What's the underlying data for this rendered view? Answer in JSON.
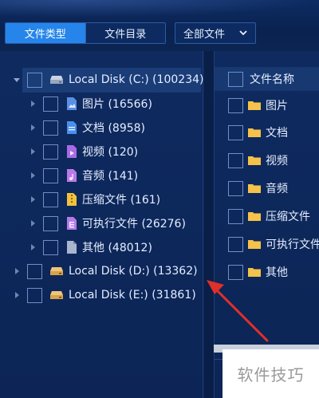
{
  "toolbar": {
    "tabs": [
      {
        "label": "文件类型",
        "active": true
      },
      {
        "label": "文件目录",
        "active": false
      }
    ],
    "filter": {
      "selected": "全部文件"
    }
  },
  "tree": {
    "disks": [
      {
        "label": "Local Disk (C:) (100234)",
        "expanded": true,
        "children": [
          {
            "label": "图片 (16566)",
            "icon": "image-file-icon",
            "color": "#5a8fe6"
          },
          {
            "label": "文档 (8958)",
            "icon": "document-file-icon",
            "color": "#4a8ef0"
          },
          {
            "label": "视频 (120)",
            "icon": "video-file-icon",
            "color": "#a86be8"
          },
          {
            "label": "音频 (141)",
            "icon": "audio-file-icon",
            "color": "#b97ae8"
          },
          {
            "label": "压缩文件 (161)",
            "icon": "archive-file-icon",
            "color": "#f2c23a"
          },
          {
            "label": "可执行文件 (26276)",
            "icon": "executable-file-icon",
            "color": "#b57be8"
          },
          {
            "label": "其他 (48012)",
            "icon": "other-file-icon",
            "color": "#a9b6cf"
          }
        ]
      },
      {
        "label": "Local Disk (D:) (13362)",
        "expanded": false
      },
      {
        "label": "Local Disk (E:) (31861)",
        "expanded": false
      }
    ]
  },
  "list": {
    "header": "文件名称",
    "items": [
      "图片",
      "文档",
      "视频",
      "音频",
      "压缩文件",
      "可执行文件",
      "其他"
    ]
  },
  "watermark": {
    "text": "软件技巧"
  },
  "colors": {
    "accent": "#2585ea",
    "background": "#0c2452",
    "folder": "#f5c24a",
    "annotation": "#e0302a"
  }
}
